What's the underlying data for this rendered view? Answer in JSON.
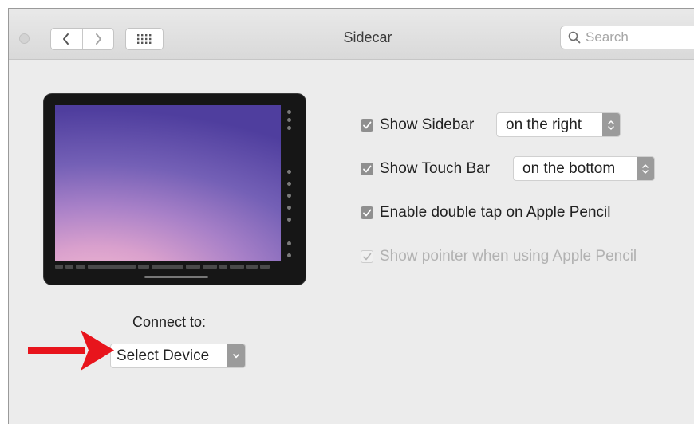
{
  "window": {
    "title": "Sidecar",
    "search": {
      "placeholder": "Search",
      "value": ""
    }
  },
  "toolbar": {
    "back_icon": "chevron-left-icon",
    "forward_icon": "chevron-right-icon",
    "show_all_icon": "grid-icon"
  },
  "preview": {
    "device": "ipad-preview"
  },
  "connect": {
    "label": "Connect to:",
    "selected": "Select Device"
  },
  "options": {
    "show_sidebar": {
      "label": "Show Sidebar",
      "checked": true,
      "position": "on the right"
    },
    "show_touch_bar": {
      "label": "Show Touch Bar",
      "checked": true,
      "position": "on the bottom"
    },
    "double_tap": {
      "label": "Enable double tap on Apple Pencil",
      "checked": true
    },
    "show_pointer": {
      "label": "Show pointer when using Apple Pencil",
      "checked": true,
      "enabled": false
    }
  },
  "annotation": {
    "arrow_color": "#e8141c"
  },
  "colors": {
    "window_bg": "#ececec",
    "checkbox": "#8f8f8f"
  }
}
